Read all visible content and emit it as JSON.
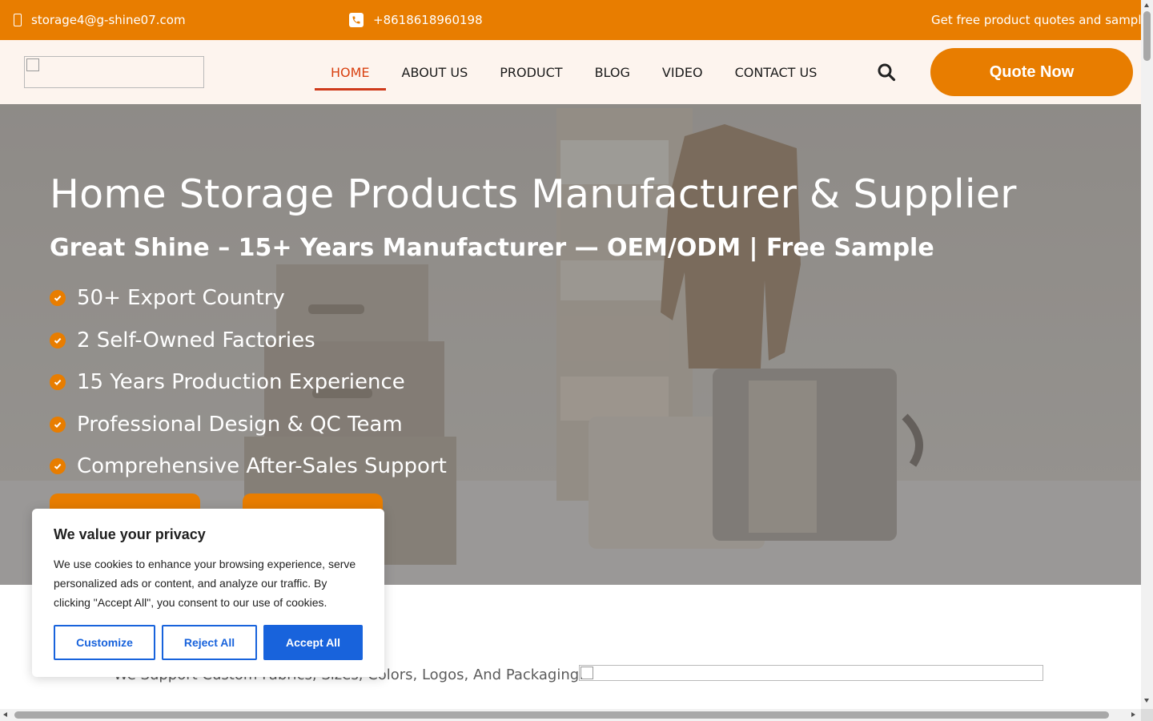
{
  "topbar": {
    "email": "storage4@g-shine07.com",
    "phone": "+8618618960198",
    "promo": "Get free product quotes and samples",
    "email_icon": "mobile-icon",
    "phone_icon": "phone-square-icon"
  },
  "header": {
    "nav": [
      {
        "label": "HOME",
        "active": true
      },
      {
        "label": "ABOUT US"
      },
      {
        "label": "PRODUCT"
      },
      {
        "label": "BLOG"
      },
      {
        "label": "VIDEO"
      },
      {
        "label": "CONTACT US"
      }
    ],
    "quote_label": "Quote Now",
    "search_icon": "search-icon"
  },
  "hero": {
    "title": "Home Storage Products Manufacturer & Supplier",
    "subtitle": "Great Shine – 15+ Years Manufacturer — OEM/ODM | Free Sample",
    "features": [
      "50+ Export Country",
      "2 Self-Owned Factories",
      "15 Years Production Experience",
      "Professional Design & QC Team",
      "Comprehensive After-Sales Support"
    ]
  },
  "section": {
    "text": "We Support Custom Fabrics, Sizes, Colors, Logos, And Packaging."
  },
  "cookie": {
    "title": "We value your privacy",
    "body": "We use cookies to enhance your browsing experience, serve personalized ads or content, and analyze our traffic. By clicking \"Accept All\", you consent to our use of cookies.",
    "customize": "Customize",
    "reject": "Reject All",
    "accept": "Accept All"
  },
  "colors": {
    "accent": "#e87d00",
    "nav_active": "#d94212",
    "cookie_blue": "#1863dc"
  }
}
